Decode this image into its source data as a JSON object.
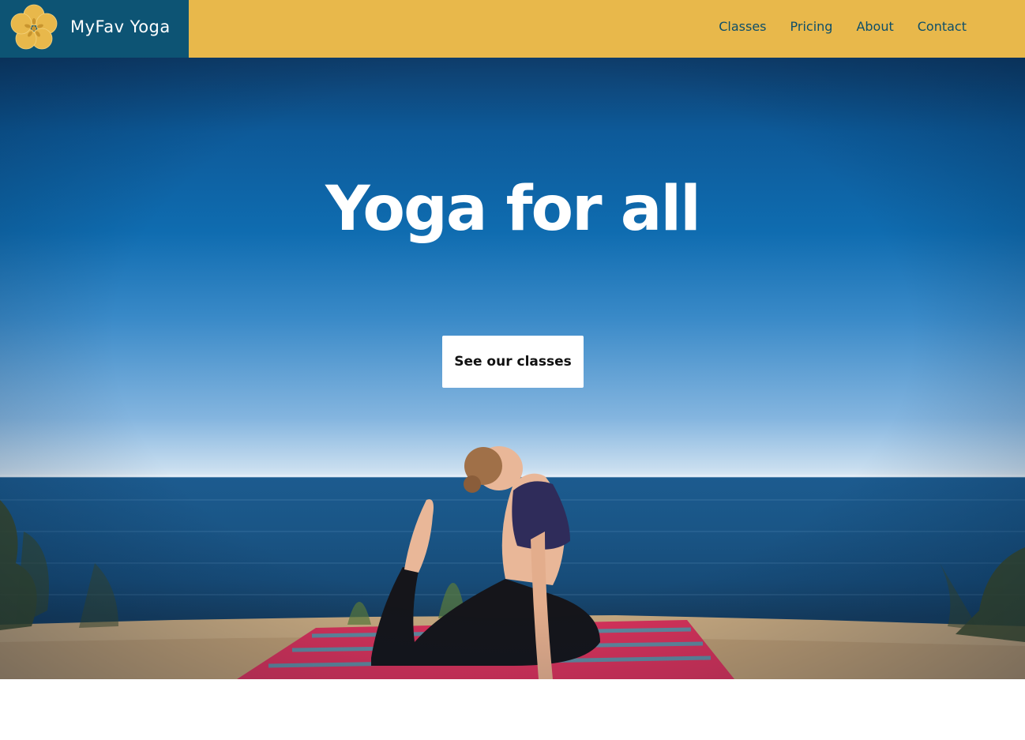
{
  "brand": {
    "name": "MyFav Yoga",
    "logo_icon": "flower-icon"
  },
  "nav": {
    "items": [
      {
        "label": "Classes"
      },
      {
        "label": "Pricing"
      },
      {
        "label": "About"
      },
      {
        "label": "Contact"
      }
    ]
  },
  "hero": {
    "title": "Yoga for all",
    "cta_label": "See our classes",
    "image_alt": "yoga-pose-by-the-sea"
  },
  "colors": {
    "header": "#e8b84b",
    "brand_bg": "#0d5474",
    "nav_text": "#0d4f6a",
    "cta_bg": "#ffffff"
  }
}
